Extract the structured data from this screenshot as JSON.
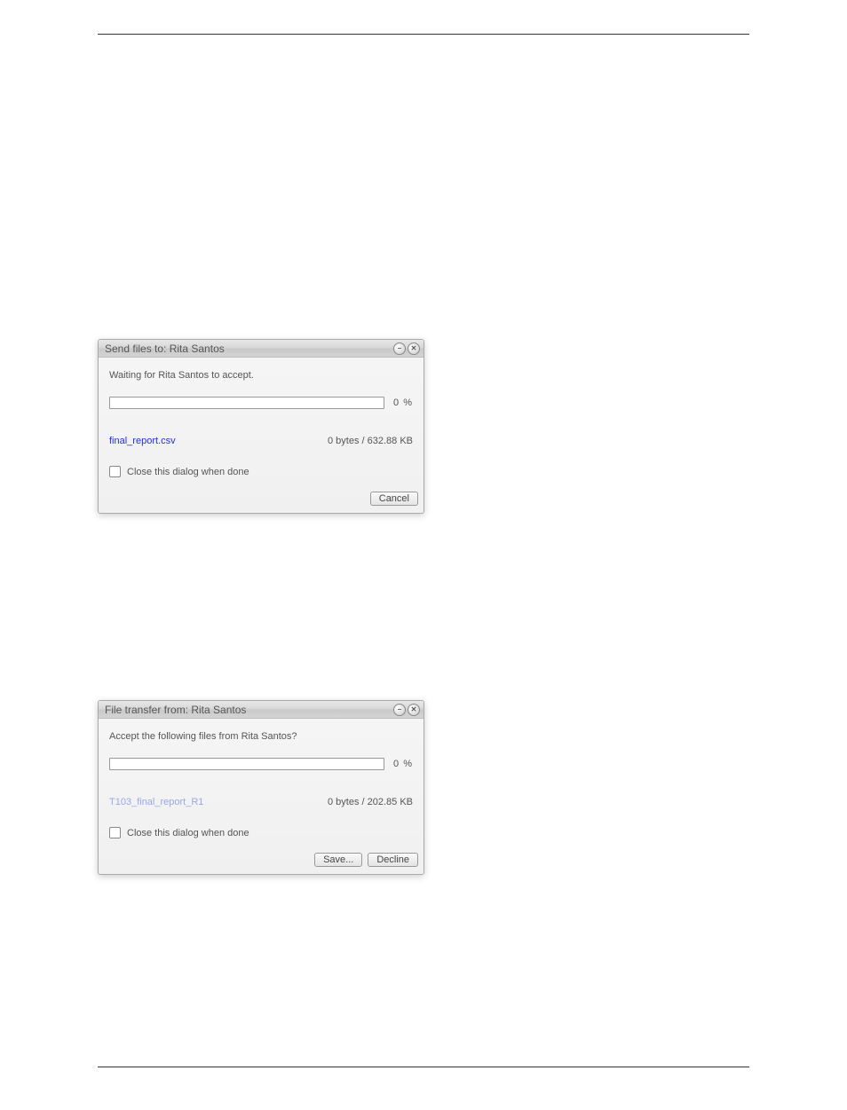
{
  "dialog1": {
    "title": "Send files to: Rita Santos",
    "message": "Waiting for Rita Santos to accept.",
    "percent": "0  %",
    "filename": "final_report.csv",
    "filesize": "0 bytes  /  632.88 KB",
    "checkbox_label": "Close this dialog when done",
    "cancel": "Cancel"
  },
  "dialog2": {
    "title": "File transfer from: Rita Santos",
    "message": "Accept the following files from Rita Santos?",
    "percent": "0  %",
    "filename": "T103_final_report_R1",
    "filesize": "0 bytes  /  202.85 KB",
    "checkbox_label": "Close this dialog when done",
    "save": "Save...",
    "decline": "Decline"
  }
}
